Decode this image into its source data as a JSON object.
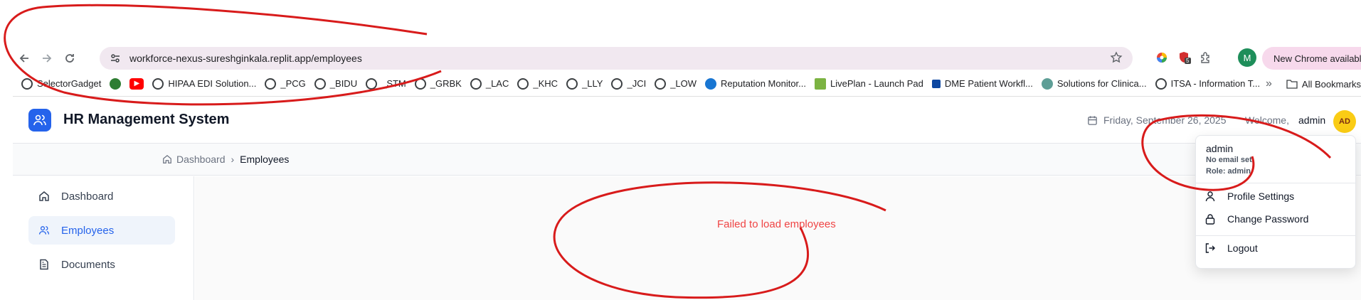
{
  "browser": {
    "url": "workforce-nexus-sureshginkala.replit.app/employees",
    "update_label": "New Chrome available",
    "profile_initial": "M",
    "extension_badge": "5",
    "bookmarks": [
      {
        "label": "SelectorGadget",
        "icon": "globe-icon",
        "color": "#3c4043"
      },
      {
        "label": "",
        "icon": "leaf-icon",
        "color": "#2e7d32"
      },
      {
        "label": "",
        "icon": "youtube-icon",
        "color": "#ff0000"
      },
      {
        "label": "HIPAA EDI Solution...",
        "icon": "globe-icon",
        "color": "#3c4043"
      },
      {
        "label": "_PCG",
        "icon": "globe-icon",
        "color": "#3c4043"
      },
      {
        "label": "_BIDU",
        "icon": "globe-icon",
        "color": "#3c4043"
      },
      {
        "label": "_STM",
        "icon": "globe-icon",
        "color": "#3c4043"
      },
      {
        "label": "_GRBK",
        "icon": "globe-icon",
        "color": "#3c4043"
      },
      {
        "label": "_LAC",
        "icon": "globe-icon",
        "color": "#3c4043"
      },
      {
        "label": "_KHC",
        "icon": "globe-icon",
        "color": "#3c4043"
      },
      {
        "label": "_LLY",
        "icon": "globe-icon",
        "color": "#3c4043"
      },
      {
        "label": "_JCI",
        "icon": "globe-icon",
        "color": "#3c4043"
      },
      {
        "label": "_LOW",
        "icon": "globe-icon",
        "color": "#3c4043"
      },
      {
        "label": "Reputation Monitor...",
        "icon": "check-icon",
        "color": "#1976d2"
      },
      {
        "label": "LivePlan - Launch Pad",
        "icon": "bars-icon",
        "color": "#7cb342"
      },
      {
        "label": "DME Patient Workfl...",
        "icon": "doc-icon",
        "color": "#0d47a1"
      },
      {
        "label": "Solutions for Clinica...",
        "icon": "leaf-icon",
        "color": "#5e9e96"
      },
      {
        "label": "ITSA - Information T...",
        "icon": "globe-icon",
        "color": "#3c4043"
      }
    ],
    "all_bookmarks_label": "All Bookmarks"
  },
  "app": {
    "title": "HR Management System",
    "date": "Friday, September 26, 2025",
    "welcome": "Welcome,",
    "username": "admin",
    "avatar_initials": "AD"
  },
  "breadcrumb": {
    "home": "Dashboard",
    "current": "Employees"
  },
  "sidebar": {
    "items": [
      {
        "label": "Dashboard",
        "icon": "home-icon",
        "active": false
      },
      {
        "label": "Employees",
        "icon": "users-icon",
        "active": true
      },
      {
        "label": "Documents",
        "icon": "document-icon",
        "active": false
      }
    ]
  },
  "main": {
    "error": "Failed to load employees"
  },
  "dropdown": {
    "name": "admin",
    "email": "No email set",
    "role": "Role: admin",
    "items": [
      {
        "label": "Profile Settings",
        "icon": "user-icon"
      },
      {
        "label": "Change Password",
        "icon": "lock-icon"
      },
      {
        "label": "Logout",
        "icon": "logout-icon"
      }
    ]
  },
  "colors": {
    "accent": "#2563eb",
    "error": "#ef4444",
    "annotation": "#d81b1b"
  }
}
